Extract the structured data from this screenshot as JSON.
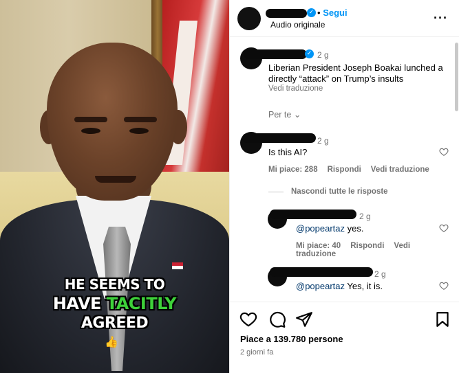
{
  "video": {
    "caption_line1": "HE SEEMS TO",
    "caption_line2_a": "HAVE ",
    "caption_line2_b": "TACITLY",
    "caption_line3": "AGREED",
    "caption_emoji": "👍",
    "highlight_color": "#3ed13a"
  },
  "header": {
    "dot": "•",
    "follow_label": "Segui",
    "audio_label": "Audio originale",
    "more_icon": "more-horizontal-icon"
  },
  "caption_post": {
    "time": "2 g",
    "text": "Liberian President Joseph Boakai lunched a directly “attack” on Trump’s insults",
    "translate_label": "Vedi traduzione"
  },
  "sort": {
    "label": "Per te",
    "chevron": "⌄"
  },
  "comments": [
    {
      "time": "2 g",
      "text": "Is this AI?",
      "likes_label": "Mi piace: 288",
      "reply_label": "Rispondi",
      "translate_label": "Vedi traduzione"
    }
  ],
  "hide_replies_label": "Nascondi tutte le risposte",
  "replies": [
    {
      "time": "2 g",
      "mention": "@popeartaz",
      "text": " yes.",
      "likes_label": "Mi piace: 40",
      "reply_label": "Rispondi",
      "translate_label": "Vedi traduzione"
    },
    {
      "time": "2 g",
      "mention": "@popeartaz",
      "text": " Yes, it is."
    }
  ],
  "footer": {
    "likes_text": "Piace a 139.780 persone",
    "date_text": "2 giorni fa"
  },
  "colors": {
    "accent": "#0095f6",
    "muted": "#737373",
    "mention": "#00376b"
  }
}
